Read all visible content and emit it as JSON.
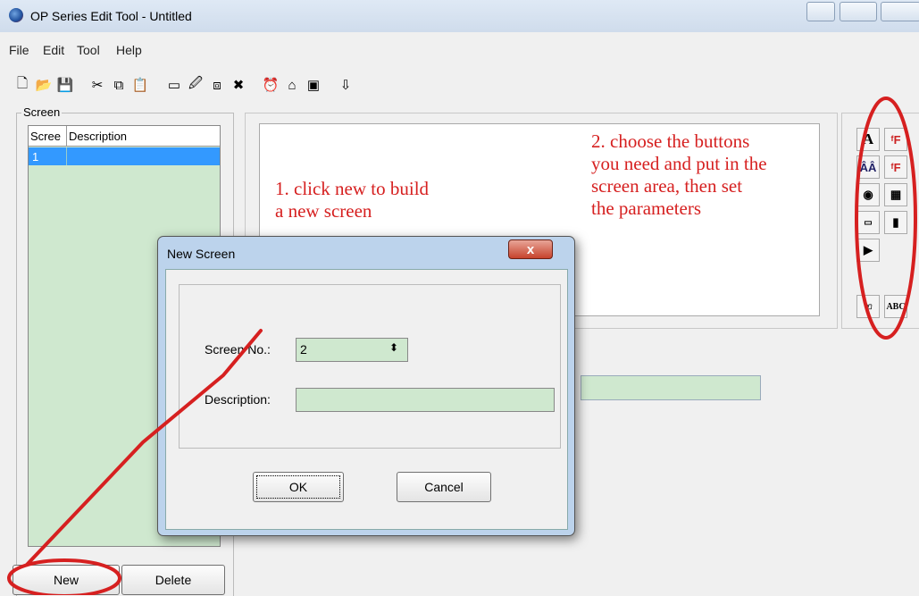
{
  "window": {
    "title": "OP Series Edit Tool - Untitled"
  },
  "menu": {
    "items": [
      "File",
      "Edit",
      "Tool",
      "Help"
    ]
  },
  "screen_panel": {
    "group_label": "Screen",
    "columns": [
      "Scree",
      "Description"
    ],
    "rows": [
      {
        "no": "1",
        "description": ""
      }
    ],
    "new_button": "New",
    "delete_button": "Delete"
  },
  "annotations": {
    "note1_line1": "1. click new to build",
    "note1_line2": "a new screen",
    "note2_line1": "2. choose the buttons",
    "note2_line2": "you need and put in the",
    "note2_line3": "screen area, then set",
    "note2_line4": "the parameters",
    "color": "#d62020"
  },
  "palette": {
    "text_label": "A",
    "abc_label": "ABC"
  },
  "dialog": {
    "title": "New Screen",
    "close_label": "x",
    "screen_no_label": "Screen No.:",
    "screen_no_value": "2",
    "description_label": "Description:",
    "description_value": "",
    "ok_label": "OK",
    "cancel_label": "Cancel"
  }
}
